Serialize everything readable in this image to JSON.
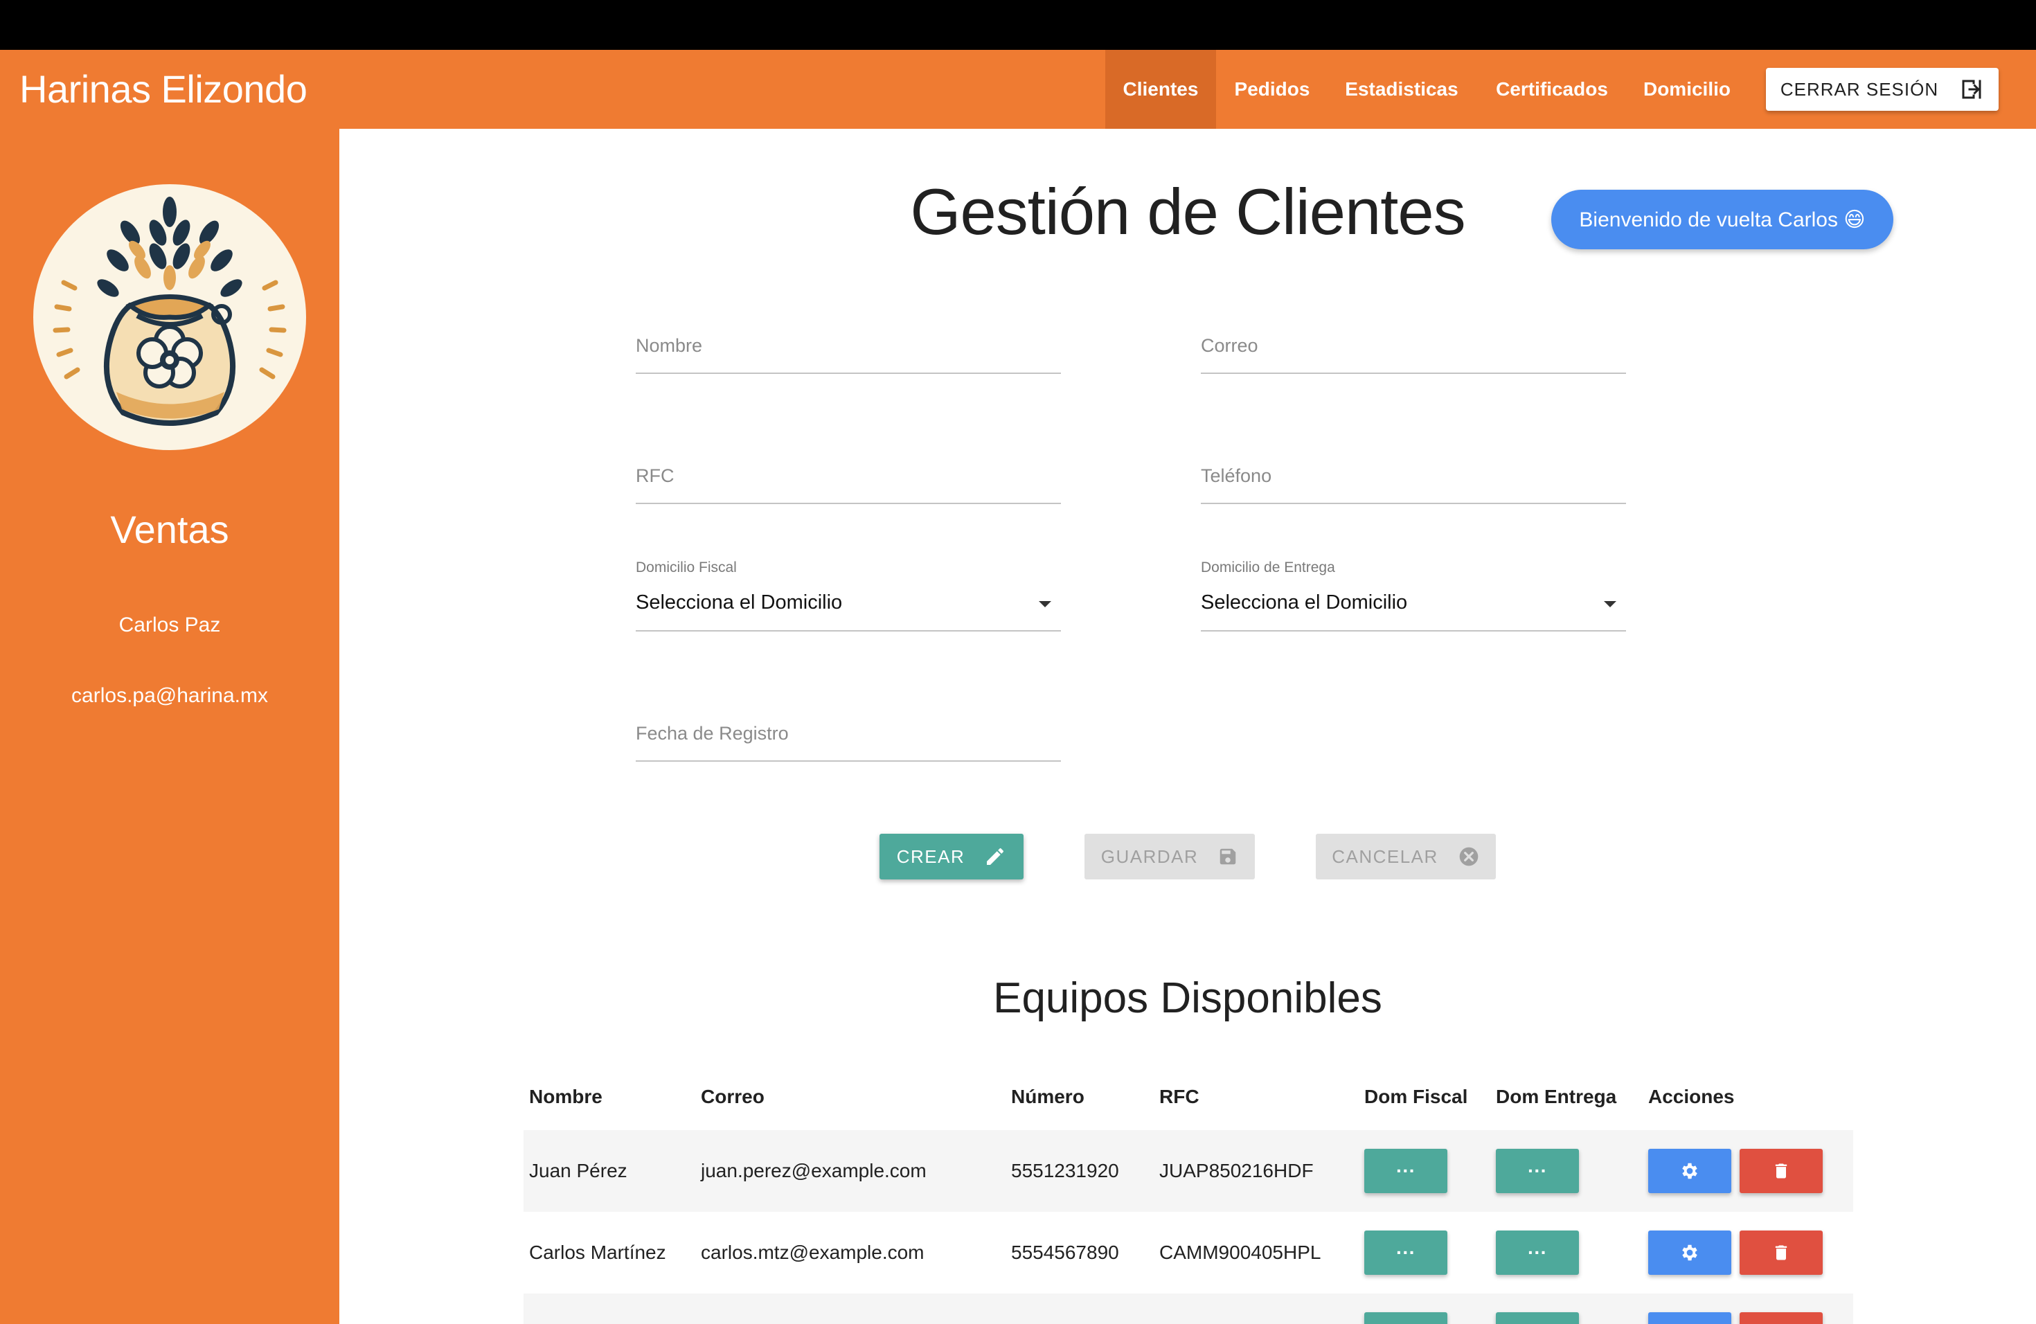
{
  "navbar": {
    "brand": "Harinas Elizondo",
    "links": [
      "Clientes",
      "Pedidos",
      "Estadisticas",
      "Certificados",
      "Domicilio"
    ],
    "active": "Clientes",
    "logout_label": "CERRAR SESIÓN",
    "logout_icon": "exit-icon",
    "color": "#ef7b32"
  },
  "sidebar": {
    "logo_icon": "wheat-flour-sack-icon",
    "role": "Ventas",
    "user_name": "Carlos Paz",
    "user_email": "carlos.pa@harina.mx"
  },
  "main": {
    "title": "Gestión de Clientes",
    "welcome": "Bienvenido de vuelta Carlos 😄"
  },
  "form": {
    "nombre_placeholder": "Nombre",
    "correo_placeholder": "Correo",
    "rfc_placeholder": "RFC",
    "telefono_placeholder": "Teléfono",
    "domicilio_fiscal_label": "Domicilio Fiscal",
    "domicilio_fiscal_value": "Selecciona el Domicilio",
    "domicilio_entrega_label": "Domicilio de Entrega",
    "domicilio_entrega_value": "Selecciona el Domicilio",
    "fecha_placeholder": "Fecha de Registro"
  },
  "actions": {
    "crear": "CREAR",
    "crear_icon": "pencil-icon",
    "guardar": "GUARDAR",
    "guardar_icon": "save-icon",
    "cancelar": "CANCELAR",
    "cancelar_icon": "close-circle-icon"
  },
  "table": {
    "title": "Equipos Disponibles",
    "headers": [
      "Nombre",
      "Correo",
      "Número",
      "RFC",
      "Dom Fiscal",
      "Dom Entrega",
      "Acciones"
    ],
    "rows": [
      {
        "nombre": "Juan Pérez",
        "correo": "juan.perez@example.com",
        "numero": "5551231920",
        "rfc": "JUAP850216HDF"
      },
      {
        "nombre": "Carlos Martínez",
        "correo": "carlos.mtz@example.com",
        "numero": "5554567890",
        "rfc": "CAMM900405HPL"
      },
      {
        "nombre": "",
        "correo": "",
        "numero": "",
        "rfc": ""
      }
    ],
    "more_label": "···"
  }
}
